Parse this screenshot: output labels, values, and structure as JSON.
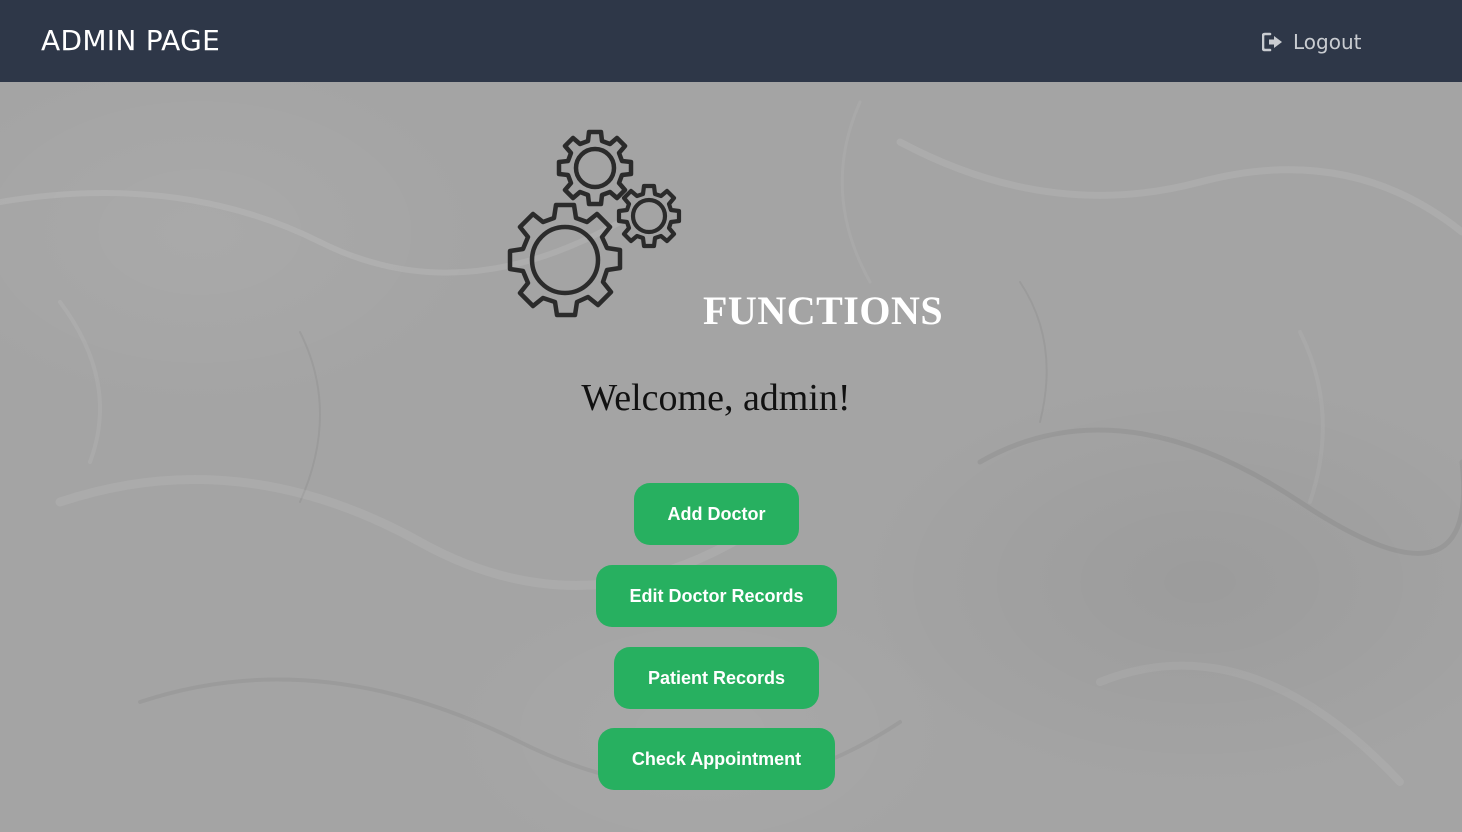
{
  "navbar": {
    "brand": "ADMIN PAGE",
    "logout_label": "Logout",
    "logout_icon": "sign-out-icon",
    "background": "#2e3748"
  },
  "main": {
    "logo_icon": "gears-icon",
    "functions_title": "FUNCTIONS",
    "welcome_text": "Welcome, admin!",
    "buttons": [
      {
        "label": "Add Doctor"
      },
      {
        "label": "Edit Doctor Records"
      },
      {
        "label": "Patient Records"
      },
      {
        "label": "Check Appointment"
      }
    ],
    "button_color": "#27b060"
  }
}
